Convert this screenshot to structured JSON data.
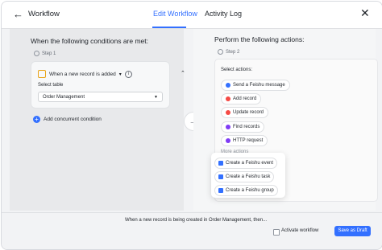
{
  "header": {
    "title": "Workflow",
    "tabs": [
      {
        "label": "Edit Workflow",
        "active": true
      },
      {
        "label": "Activity Log",
        "active": false
      }
    ]
  },
  "left": {
    "section_title": "When the following conditions are met:",
    "step": "Step 1",
    "trigger_label": "When a new record is added",
    "select_table_label": "Select table",
    "select_table_value": "Order Management",
    "add_condition": "Add concurrent condition"
  },
  "right": {
    "section_title": "Perform the following actions:",
    "step": "Step 2",
    "select_actions_label": "Select actions:",
    "actions": [
      {
        "label": "Send a Feishu message",
        "color": "#3370ff"
      },
      {
        "label": "Add record",
        "color": "#f54a45"
      },
      {
        "label": "Update record",
        "color": "#f54a45"
      },
      {
        "label": "Find records",
        "color": "#7f3bf5"
      },
      {
        "label": "HTTP request",
        "color": "#7f3bf5"
      }
    ],
    "more_actions": "More actions",
    "popup": [
      {
        "label": "Create a Feishu event",
        "color": "#3370ff"
      },
      {
        "label": "Create a Feishu task",
        "color": "#3370ff"
      },
      {
        "label": "Create a Feishu group",
        "color": "#3370ff"
      }
    ]
  },
  "footer": {
    "summary": "When a new record is being created in Order Management, then...",
    "activate_label": "Activate workflow",
    "save_label": "Save as Draft"
  },
  "colors": {
    "accent": "#3370ff",
    "trigger_icon": "#e8a317"
  }
}
